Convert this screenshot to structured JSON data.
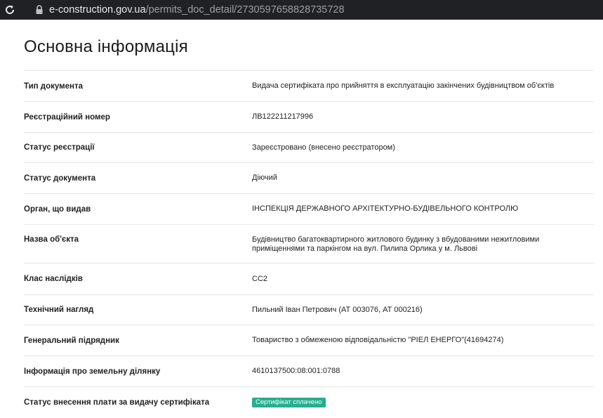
{
  "browser": {
    "url_host": "e-construction.gov.ua",
    "url_path": "/permits_doc_detail/2730597658828735728"
  },
  "page": {
    "title": "Основна інформація"
  },
  "rows": [
    {
      "label": "Тип документа",
      "value": "Видача сертифіката про прийняття в експлуатацію закінчених будівництвом об'єктів"
    },
    {
      "label": "Реєстраційний номер",
      "value": "ЛВ122211217996"
    },
    {
      "label": "Статус реєстрації",
      "value": "Зареєстровано (внесено реєстратором)"
    },
    {
      "label": "Статус документа",
      "value": "Діючий"
    },
    {
      "label": "Орган, що видав",
      "value": "ІНСПЕКЦІЯ ДЕРЖАВНОГО АРХІТЕКТУРНО-БУДІВЕЛЬНОГО КОНТРОЛЮ"
    },
    {
      "label": "Назва об'єкта",
      "value": "Будівництво багатоквартирного житлового будинку з вбудованими нежитловими приміщеннями та паркінгом на вул. Пилипа Орлика у м. Львові"
    },
    {
      "label": "Клас наслідків",
      "value": "СС2"
    },
    {
      "label": "Технічний нагляд",
      "value": "Пильний Іван Петрович (АТ 003076, АТ 000216)"
    },
    {
      "label": "Генеральний підрядник",
      "value": "Товариство з обмеженою відповідальністю \"РІЕЛ ЕНЕРГО\"(41694274)"
    },
    {
      "label": "Інформація про земельну ділянку",
      "value": "4610137500:08:001:0788"
    },
    {
      "label": "Статус внесення плати за видачу сертифіката",
      "value": "Сертифікат сплачено"
    }
  ],
  "colors": {
    "badge": "#27ae8f",
    "topbar": "#202124"
  }
}
